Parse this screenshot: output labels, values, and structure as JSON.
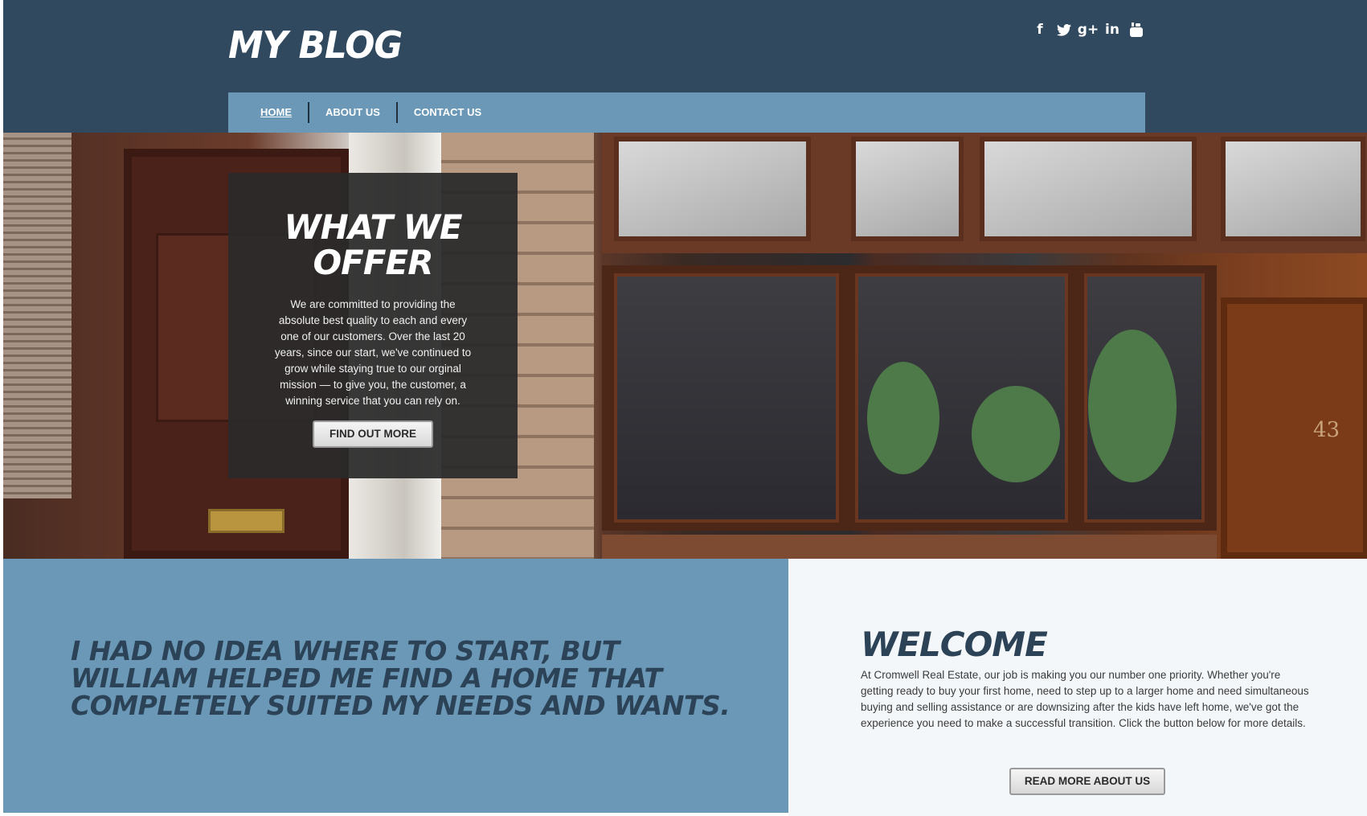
{
  "header": {
    "logo": "MY BLOG",
    "social": [
      {
        "icon": "facebook-icon",
        "glyph": "f"
      },
      {
        "icon": "twitter-icon",
        "glyph": "🐦"
      },
      {
        "icon": "google-plus-icon",
        "glyph": "g+"
      },
      {
        "icon": "linkedin-icon",
        "glyph": "in"
      },
      {
        "icon": "youtube-icon",
        "glyph": "▶"
      }
    ],
    "nav": {
      "home": "HOME",
      "about": "ABOUT US",
      "contact": "CONTACT US"
    }
  },
  "hero": {
    "title": "WHAT WE OFFER",
    "text": "We are committed to providing the absolute best quality to each and every one of our customers. Over the last 20 years, since our start, we've continued to grow while staying true to our orginal mission — to give you, the customer, a winning service that you can rely on.",
    "button": "FIND OUT MORE",
    "door_number": "43"
  },
  "testimonial": {
    "quote": "I HAD NO IDEA WHERE TO START, BUT WILLIAM HELPED ME FIND A HOME THAT COMPLETELY SUITED MY NEEDS AND WANTS."
  },
  "welcome": {
    "title": "WELCOME",
    "text": "At Cromwell Real Estate, our job is making you our number one priority. Whether you're getting ready to buy your first home, need to step up to a larger home and need simultaneous buying and selling assistance or are downsizing after the kids have left home, we've got the experience you need to make a successful transition. Click the button below for more details.",
    "button": "READ MORE ABOUT US"
  },
  "colors": {
    "header_bg": "#30495f",
    "nav_bg": "#6a98b6",
    "accent_dark": "#2c4357",
    "welcome_bg": "#f3f7f9"
  }
}
